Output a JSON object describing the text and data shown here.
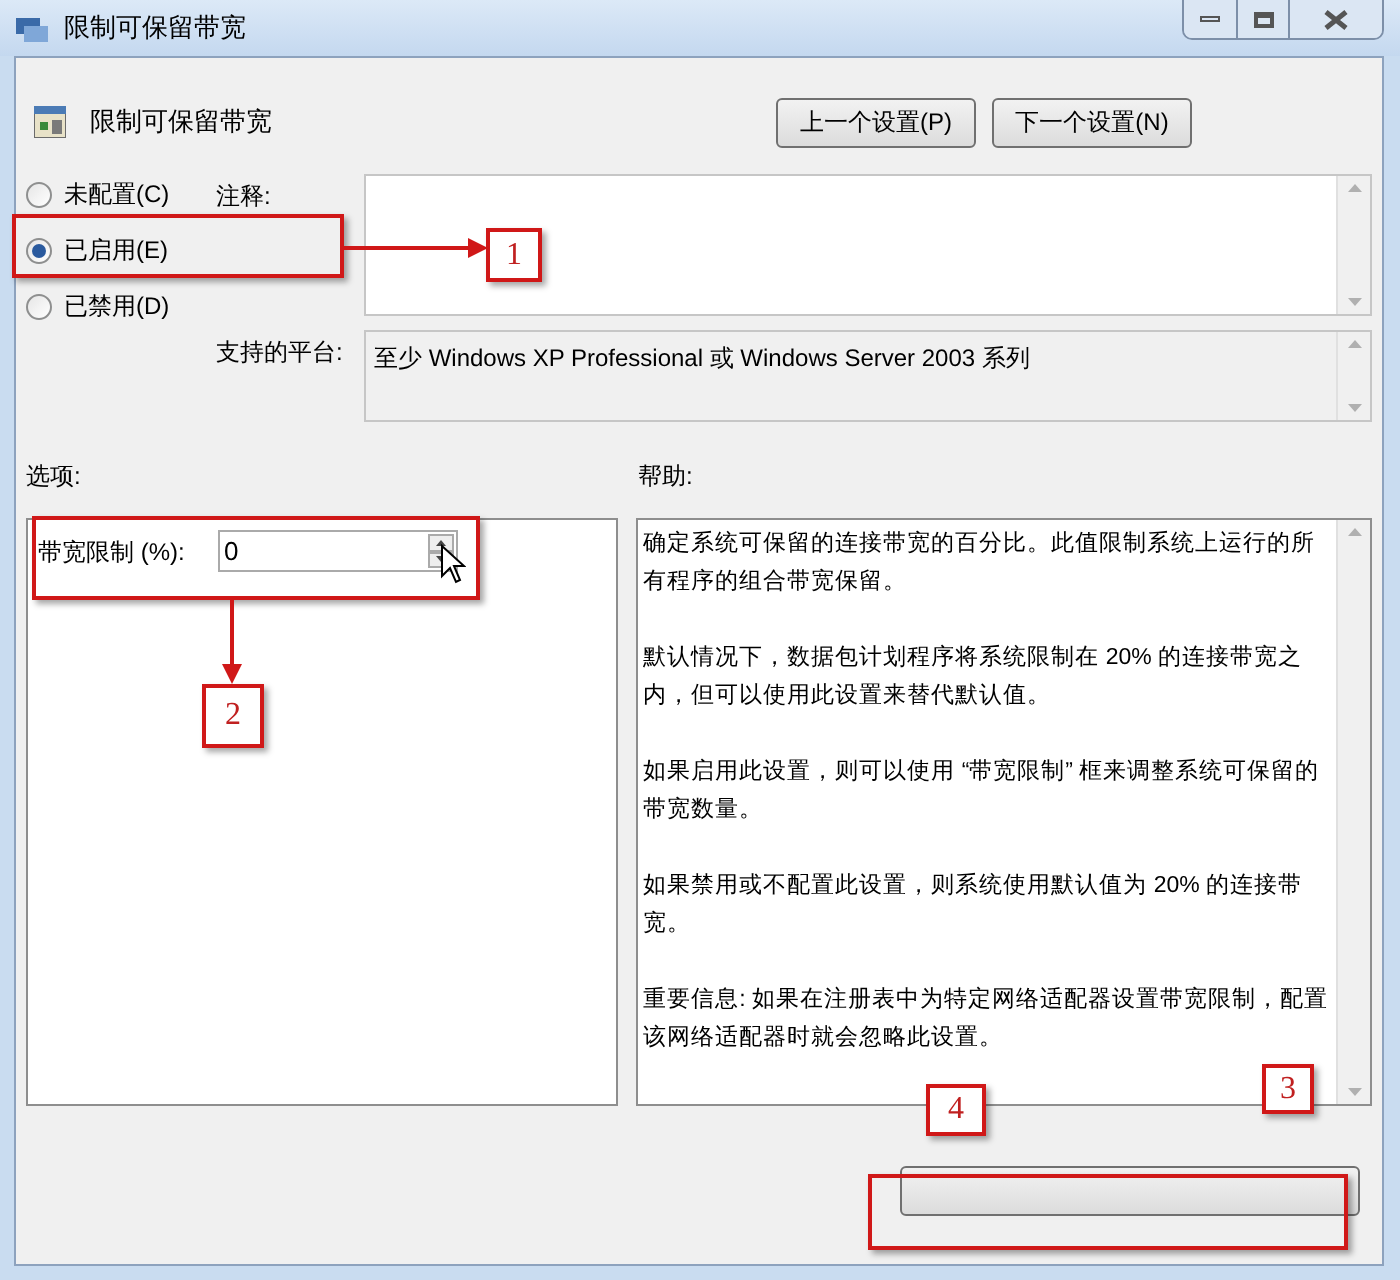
{
  "window": {
    "title": "限制可保留带宽"
  },
  "header": {
    "title": "限制可保留带宽"
  },
  "nav_buttons": [
    "上一个设置(P)",
    "下一个设置(N)"
  ],
  "state_options": [
    {
      "label": "未配置(C)",
      "selected": false
    },
    {
      "label": "已启用(E)",
      "selected": true
    },
    {
      "label": "已禁用(D)",
      "selected": false
    }
  ],
  "comment": {
    "label": "注释:"
  },
  "platform": {
    "label": "支持的平台:",
    "value": "至少 Windows XP Professional 或 Windows Server 2003 系列"
  },
  "options": {
    "label": "选项:",
    "field_label": "带宽限制 (%):",
    "value": "0"
  },
  "help": {
    "label": "帮助:",
    "paragraphs": [
      "确定系统可保留的连接带宽的百分比。此值限制系统上运行的所有程序的组合带宽保留。",
      "默认情况下，数据包计划程序将系统限制在 20% 的连接带宽之内，但可以使用此设置来替代默认值。",
      "如果启用此设置，则可以使用 “带宽限制” 框来调整系统可保留的带宽数量。",
      "如果禁用或不配置此设置，则系统使用默认值为 20% 的连接带宽。",
      "重要信息: 如果在注册表中为特定网络适配器设置带宽限制，配置该网络适配器时就会忽略此设置。"
    ]
  },
  "callouts": [
    "1",
    "2",
    "3",
    "4"
  ]
}
